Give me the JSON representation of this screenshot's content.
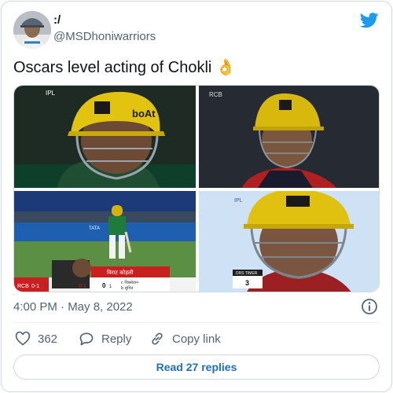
{
  "user": {
    "display_name": ":/",
    "handle": "@MSDhoniwarriors",
    "avatar_icon": "profile-photo"
  },
  "brand": {
    "logo_icon": "twitter-bird-icon",
    "color": "#1d9bf0"
  },
  "tweet": {
    "text": "Oscars level acting of Chokli",
    "emoji": "👌"
  },
  "media": {
    "image_1": {
      "watermark": "IPL",
      "helmet_brand": "boAt"
    },
    "image_2": {
      "logo": "RCB"
    },
    "image_3": {
      "banner": "TATA",
      "score_team": "RCB",
      "score": "0-1",
      "score_over": "0.1",
      "batter_name": "विराट कोहली",
      "batter_score": "0",
      "batter_balls": "1",
      "bowler_1": "c चिक्सेयान",
      "bowler_2": "b सुचित"
    },
    "image_4": {
      "watermark": "IPL",
      "timer_label": "DRS TIMER",
      "timer_value": "3"
    }
  },
  "meta": {
    "timestamp": "4:00 PM · May 8, 2022",
    "info_icon": "info-icon"
  },
  "actions": {
    "like_icon": "heart-icon",
    "like_count": "362",
    "reply_icon": "speech-bubble-icon",
    "reply_label": "Reply",
    "copy_icon": "link-icon",
    "copy_label": "Copy link"
  },
  "read_replies_label": "Read 27 replies"
}
